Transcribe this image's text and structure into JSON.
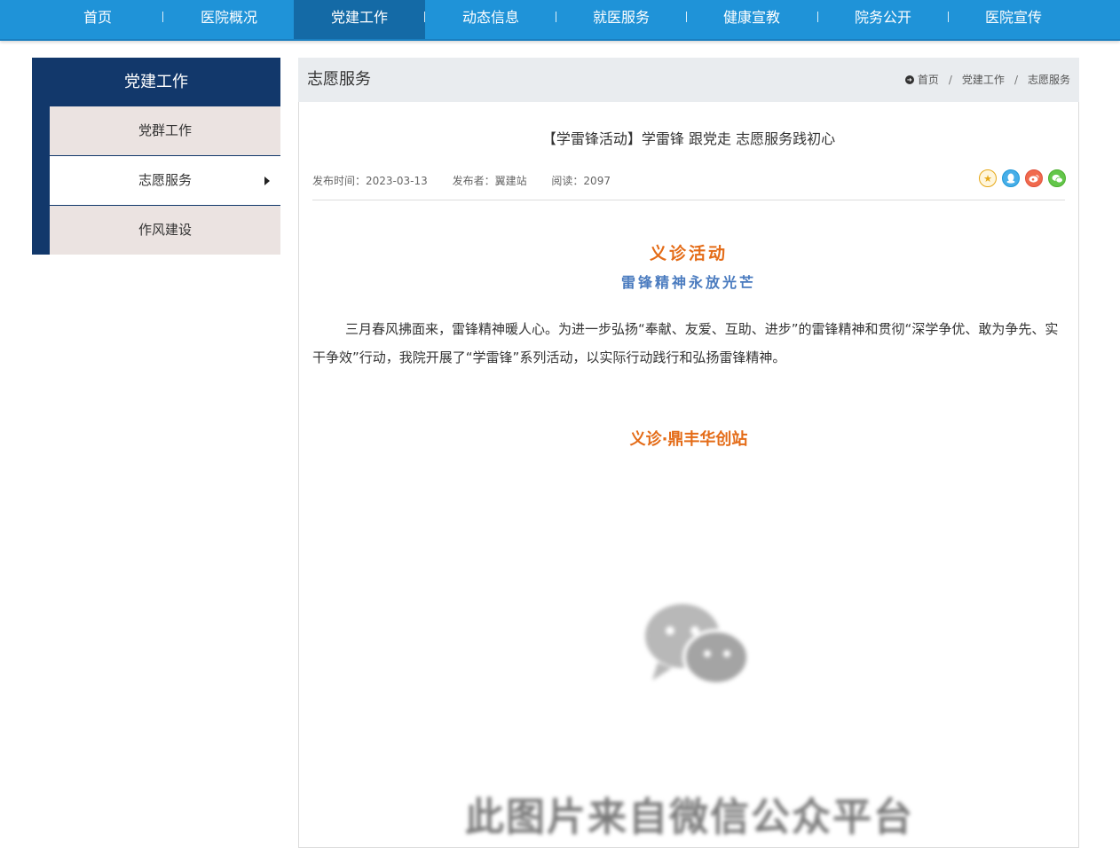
{
  "nav": {
    "items": [
      {
        "label": "首页"
      },
      {
        "label": "医院概况"
      },
      {
        "label": "党建工作"
      },
      {
        "label": "动态信息"
      },
      {
        "label": "就医服务"
      },
      {
        "label": "健康宣教"
      },
      {
        "label": "院务公开"
      },
      {
        "label": "医院宣传"
      }
    ],
    "active": "党建工作"
  },
  "sidebar": {
    "title": "党建工作",
    "items": [
      {
        "label": "党群工作"
      },
      {
        "label": "志愿服务"
      },
      {
        "label": "作风建设"
      }
    ],
    "active": "志愿服务"
  },
  "section": {
    "title": "志愿服务"
  },
  "breadcrumb": {
    "home": "首页",
    "level1": "党建工作",
    "level2": "志愿服务",
    "separator": "/"
  },
  "article": {
    "title": "【学雷锋活动】学雷锋 跟党走 志愿服务践初心",
    "publish_time": "发布时间：2023-03-13",
    "publisher": "发布者：翼建站",
    "reads": "阅读：2097",
    "heading1": "义诊活动",
    "heading2": "雷锋精神永放光芒",
    "paragraph": "三月春风拂面来，雷锋精神暖人心。为进一步弘扬“奉献、友爱、互助、进步”的雷锋精神和贯彻“深学争优、敢为争先、实干争效”行动，我院开展了“学雷锋”系列活动，以实际行动践行和弘扬雷锋精神。",
    "heading3": "义诊·鼎丰华创站",
    "image_placeholder_text": "此图片来自微信公众平台"
  },
  "share": {
    "icons": [
      "star-icon",
      "qq-icon",
      "weibo-icon",
      "wechat-icon"
    ]
  },
  "colors": {
    "nav_bg": "#1f93d8",
    "nav_active": "#146aa6",
    "sidebar_bg": "#12386b",
    "heading_orange": "#e46c18",
    "heading_blue": "#4a7bbf"
  }
}
